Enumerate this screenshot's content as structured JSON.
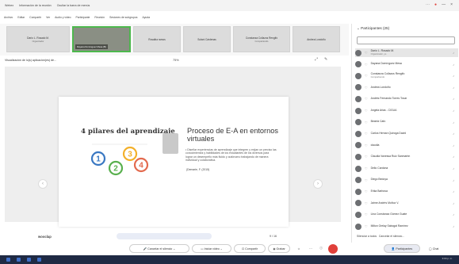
{
  "window": {
    "items": [
      "Webex",
      "Información de la reunión",
      "Ocultar la barra de menús"
    ],
    "controls": [
      "⋯",
      "●",
      "—",
      "×"
    ]
  },
  "menubar": [
    "Archivo",
    "Editar",
    "Compartir",
    "Ver",
    "Audio y video",
    "Participante",
    "Reunión",
    "Sesiones de subgrupos",
    "Ayuda"
  ],
  "video_strip": [
    {
      "name": "Darío L. Rosado M.",
      "role": "Organizador",
      "video": false
    },
    {
      "name": "Dayana Domínguez Mesa (B)",
      "role": "",
      "video": true
    },
    {
      "name": "Rosalba ramos",
      "role": "",
      "video": false
    },
    {
      "name": "Solani Cárdenas",
      "role": "",
      "video": false
    },
    {
      "name": "Constanza Collazos Rengifo",
      "role": "Compartiendo",
      "video": false
    },
    {
      "name": "Andrea Londoño",
      "role": "",
      "video": false
    }
  ],
  "share": {
    "label": "Visualización de lo(s) aplicación(es) de...",
    "zoom": "75%"
  },
  "slide": {
    "left_title": "4 pilares del aprendizaje",
    "title": "Proceso de E-A en entornos virtuales",
    "bullet": "Diseñar experiencias de aprendizaje que integren y exijan un preciso las conocimientos y habilidades de los estudiantes de los diversos para lograr un desempeño más fluido y autónomo trabajando de manera individual y colaborativa.",
    "cite": "(Demarie, F. (2015)",
    "pillars": [
      "1",
      "2",
      "3",
      "4"
    ],
    "pillar_colors": [
      "#3a78c2",
      "#59b04e",
      "#f3b02a",
      "#e36a4e"
    ]
  },
  "bottom": {
    "brand": "wooclap",
    "page": "9 / 16"
  },
  "toolbar": {
    "mute": "Cancelar el silencio",
    "video": "Iniciar video",
    "share": "Compartir",
    "record": "Grabar",
    "participants": "Participantes",
    "chat": "Chat"
  },
  "panel": {
    "header": "Participantes (25)",
    "participants": [
      {
        "name": "Darío L. Rosado M.",
        "role": "Organizador, yo",
        "selected": true
      },
      {
        "name": "Dayana Domínguez Mesa",
        "role": "",
        "selected": false
      },
      {
        "name": "Constanza Collazos Rengifo",
        "role": "Compartiendo",
        "selected": false
      },
      {
        "name": "Andrea Londoño",
        "role": "",
        "selected": false
      },
      {
        "name": "Andrés Fernando Torres Tovar",
        "role": "",
        "selected": false
      },
      {
        "name": "Angela Arias - CIGUA",
        "role": "",
        "selected": false
      },
      {
        "name": "Beatriz Cafo",
        "role": "",
        "selected": false
      },
      {
        "name": "Carlos Hernan Quiroga David",
        "role": "",
        "selected": false
      },
      {
        "name": "claudia",
        "role": "",
        "selected": false
      },
      {
        "name": "Claudia Vanessa Ruiz Sanmartín",
        "role": "",
        "selected": false
      },
      {
        "name": "Delio Cardona",
        "role": "",
        "selected": false
      },
      {
        "name": "Diego Bedoya",
        "role": "",
        "selected": false
      },
      {
        "name": "Erika Barbosa",
        "role": "",
        "selected": false
      },
      {
        "name": "Jaime Andrés Muñoz V.",
        "role": "",
        "selected": false
      },
      {
        "name": "Lina Constanza Gómez Guate",
        "role": "",
        "selected": false
      },
      {
        "name": "Milton Orelay Sabogal Ramírez",
        "role": "",
        "selected": false
      }
    ],
    "footer_mute": "Silenciar a todos",
    "footer_unmute": "Cancelar el silencio..."
  },
  "taskbar": {
    "clock": "3:04 p. m."
  }
}
